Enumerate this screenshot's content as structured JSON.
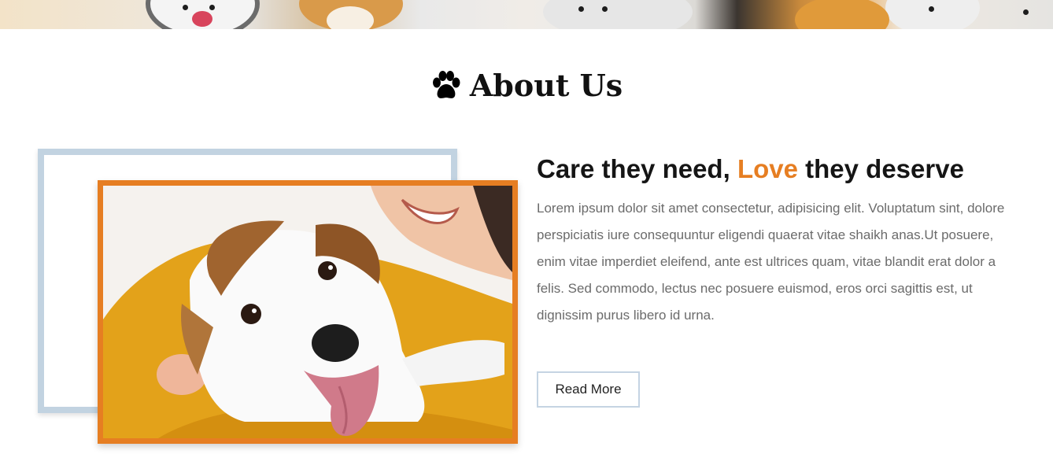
{
  "banner": {
    "alt": "pets banner"
  },
  "about": {
    "title": "About Us",
    "title_icon": "paw-icon"
  },
  "care": {
    "heading_start": "Care they need, ",
    "heading_accent": "Love",
    "heading_end": " they deserve",
    "body": "Lorem ipsum dolor sit amet consectetur, adipisicing elit. Voluptatum sint, dolore perspiciatis iure consequuntur eligendi quaerat vitae shaikh anas.Ut posuere, enim vitae imperdiet eleifend, ante est ultrices quam, vitae blandit erat dolor a felis. Sed commodo, lectus nec posuere euismod, eros orci sagittis est, ut dignissim purus libero id urna.",
    "button_label": "Read More"
  },
  "colors": {
    "accent": "#e67e22",
    "frame_back": "#c2d3e1",
    "heading": "#151515",
    "body_text": "#6b6b6b"
  }
}
